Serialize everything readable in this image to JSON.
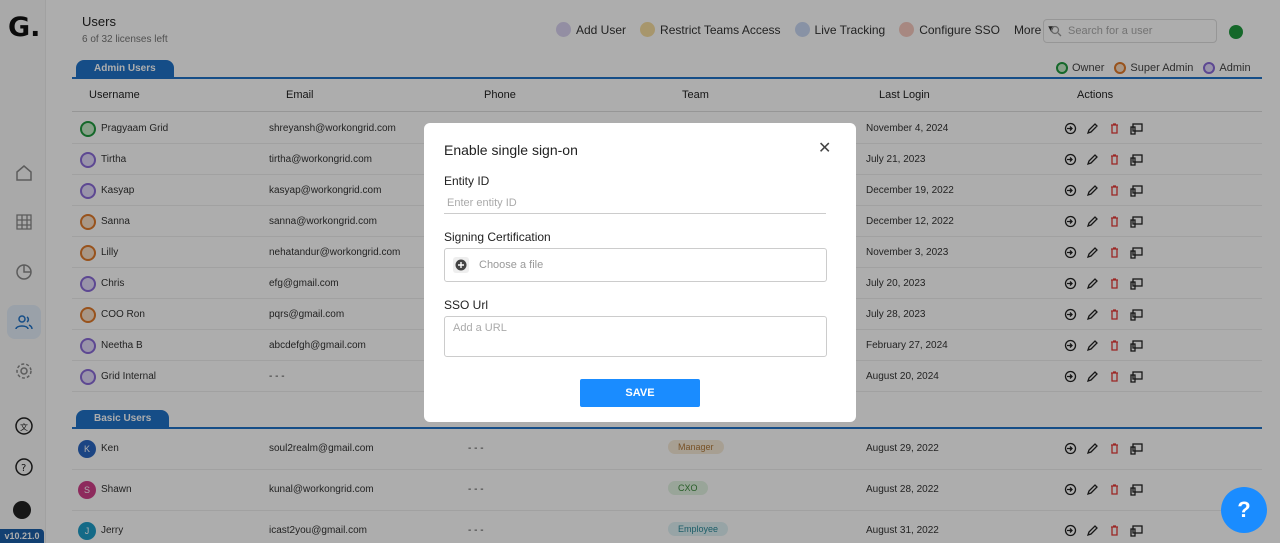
{
  "sidebar": {
    "logo": "G.",
    "version": "v10.21.0",
    "items": [
      {
        "icon": "home-icon"
      },
      {
        "icon": "grid-icon"
      },
      {
        "icon": "chart-pie-icon"
      },
      {
        "icon": "users-icon",
        "active": true
      },
      {
        "icon": "gear-icon"
      },
      {
        "icon": "translate-icon"
      },
      {
        "icon": "help-circle-icon"
      }
    ]
  },
  "header": {
    "title": "Users",
    "licenses": "6 of 32 licenses left",
    "toolbar": {
      "add_user": "Add User",
      "restrict": "Restrict Teams Access",
      "live_tracking": "Live Tracking",
      "configure_sso": "Configure SSO",
      "more": "More"
    },
    "search_placeholder": "Search for a user"
  },
  "legend": {
    "owner": "Owner",
    "super_admin": "Super Admin",
    "admin": "Admin"
  },
  "colors": {
    "accent": "#1a8cff",
    "tab": "#1f72c8",
    "owner": "#1f9a3f",
    "super_admin": "#e07a2a",
    "admin": "#8a6ad8",
    "delete": "#e53935"
  },
  "admin_section": {
    "label": "Admin Users",
    "columns": [
      "Username",
      "Email",
      "Phone",
      "Team",
      "Last Login",
      "Actions"
    ],
    "rows": [
      {
        "name": "Pragyaam Grid",
        "email": "shreyansh@workongrid.com",
        "last_login": "November 4, 2024",
        "role": "owner"
      },
      {
        "name": "Tirtha",
        "email": "tirtha@workongrid.com",
        "last_login": "July 21, 2023",
        "role": "admin"
      },
      {
        "name": "Kasyap",
        "email": "kasyap@workongrid.com",
        "last_login": "December 19, 2022",
        "role": "admin"
      },
      {
        "name": "Sanna",
        "email": "sanna@workongrid.com",
        "last_login": "December 12, 2022",
        "role": "super_admin"
      },
      {
        "name": "Lilly",
        "email": "nehatandur@workongrid.com",
        "last_login": "November 3, 2023",
        "role": "super_admin"
      },
      {
        "name": "Chris",
        "email": "efg@gmail.com",
        "last_login": "July 20, 2023",
        "role": "admin"
      },
      {
        "name": "COO Ron",
        "email": "pqrs@gmail.com",
        "last_login": "July 28, 2023",
        "role": "super_admin"
      },
      {
        "name": "Neetha B",
        "email": "abcdefgh@gmail.com",
        "last_login": "February 27, 2024",
        "role": "admin"
      },
      {
        "name": "Grid Internal",
        "email": "- - -",
        "last_login": "August 20, 2024",
        "role": "admin"
      }
    ]
  },
  "basic_section": {
    "label": "Basic Users",
    "rows": [
      {
        "initial": "K",
        "name": "Ken",
        "email": "soul2realm@gmail.com",
        "phone": "- - -",
        "team": "Manager",
        "last_login": "August 29, 2022",
        "color": "#2a66c2",
        "team_bg": "#f7ead8",
        "team_fg": "#b07a3a"
      },
      {
        "initial": "S",
        "name": "Shawn",
        "email": "kunal@workongrid.com",
        "phone": "- - -",
        "team": "CXO",
        "last_login": "August 28, 2022",
        "color": "#d0408a",
        "team_bg": "#e2f3e2",
        "team_fg": "#3c8a3c"
      },
      {
        "initial": "J",
        "name": "Jerry",
        "email": "icast2you@gmail.com",
        "phone": "- - -",
        "team": "Employee",
        "last_login": "August 31, 2022",
        "color": "#1e9cc8",
        "team_bg": "#dff2f5",
        "team_fg": "#2a8a9a"
      }
    ]
  },
  "modal": {
    "title": "Enable single sign-on",
    "entity_label": "Entity ID",
    "entity_placeholder": "Enter entity ID",
    "cert_label": "Signing Certification",
    "cert_placeholder": "Choose a file",
    "url_label": "SSO Url",
    "url_placeholder": "Add a URL",
    "save": "SAVE"
  },
  "help_fab": "?"
}
